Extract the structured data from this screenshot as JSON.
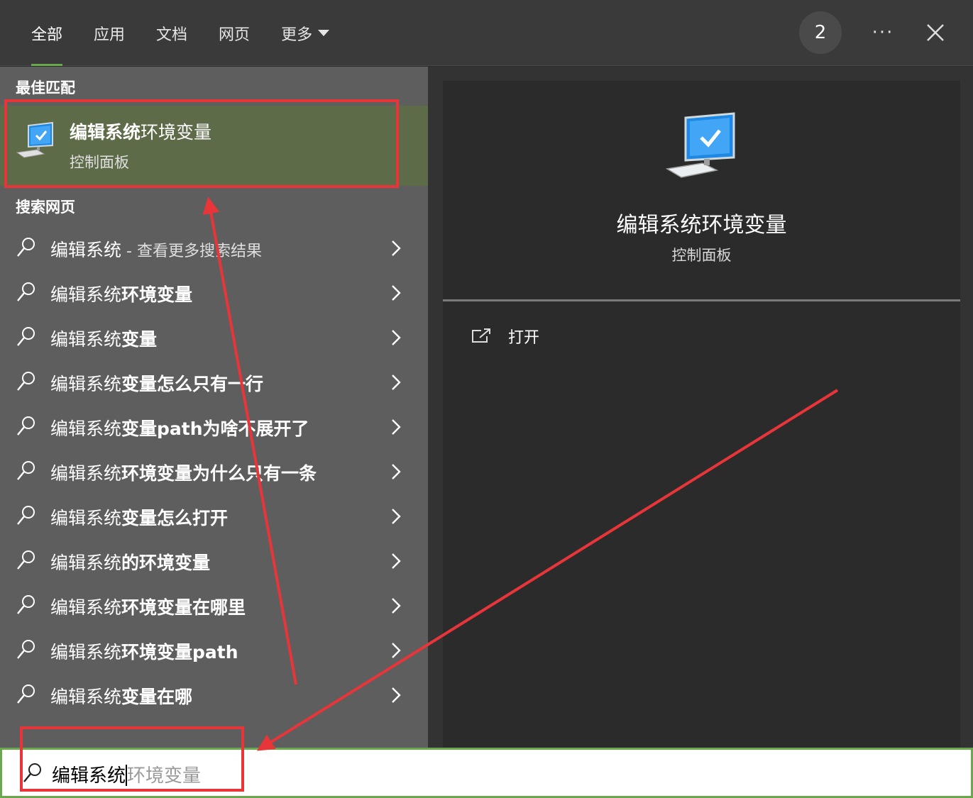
{
  "tabs": [
    {
      "label": "全部",
      "active": true
    },
    {
      "label": "应用"
    },
    {
      "label": "文档"
    },
    {
      "label": "网页"
    },
    {
      "label": "更多",
      "has_dropdown": true
    }
  ],
  "header": {
    "badge_count": "2",
    "more_icon": "ellipsis-icon",
    "close_icon": "close-icon"
  },
  "best_match": {
    "heading": "最佳匹配",
    "title_bold": "编辑系统",
    "title_rest": "环境变量",
    "subtitle": "控制面板",
    "icon": "system-properties-icon"
  },
  "web_search": {
    "heading": "搜索网页",
    "items": [
      {
        "prefix": "编辑系统",
        "bold": "",
        "suffix": " - 查看更多搜索结果"
      },
      {
        "prefix": "编辑系统",
        "bold": "环境变量",
        "suffix": ""
      },
      {
        "prefix": "编辑系统",
        "bold": "变量",
        "suffix": ""
      },
      {
        "prefix": "编辑系统",
        "bold": "变量怎么只有一行",
        "suffix": ""
      },
      {
        "prefix": "编辑系统",
        "bold": "变量path为啥不展开了",
        "suffix": ""
      },
      {
        "prefix": "编辑系统",
        "bold": "环境变量为什么只有一条",
        "suffix": ""
      },
      {
        "prefix": "编辑系统",
        "bold": "变量怎么打开",
        "suffix": ""
      },
      {
        "prefix": "编辑系统",
        "bold": "的环境变量",
        "suffix": ""
      },
      {
        "prefix": "编辑系统",
        "bold": "环境变量在哪里",
        "suffix": ""
      },
      {
        "prefix": "编辑系统",
        "bold": "环境变量path",
        "suffix": ""
      },
      {
        "prefix": "编辑系统",
        "bold": "变量在哪",
        "suffix": ""
      }
    ]
  },
  "detail": {
    "title": "编辑系统环境变量",
    "subtitle": "控制面板",
    "actions": [
      {
        "label": "打开",
        "icon": "open-external-icon"
      }
    ]
  },
  "search": {
    "typed": "编辑系统",
    "suggestion": "环境变量"
  },
  "annotation_color": "#e8353a",
  "accent_color": "#6aa84f"
}
